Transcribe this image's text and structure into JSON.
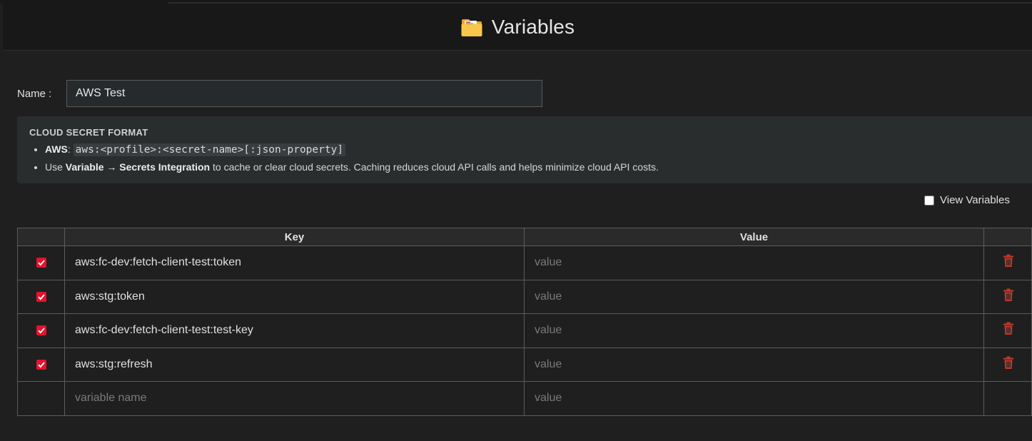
{
  "header": {
    "title": "Variables",
    "icon": "folder-icon"
  },
  "name_field": {
    "label": "Name :",
    "value": "AWS Test"
  },
  "info": {
    "heading": "CLOUD SECRET FORMAT",
    "aws_label": "AWS",
    "aws_colon": ":",
    "aws_format": "aws:<profile>:<secret-name>[:json-property]",
    "use_prefix": "Use ",
    "use_variable": "Variable",
    "use_arrow": " → ",
    "use_integration": "Secrets Integration",
    "use_suffix": " to cache or clear cloud secrets. Caching reduces cloud API calls and helps minimize cloud API costs."
  },
  "view_variables": {
    "label": "View Variables",
    "checked": false
  },
  "table": {
    "headers": {
      "check": "",
      "key": "Key",
      "value": "Value",
      "actions": ""
    },
    "rows": [
      {
        "checked": true,
        "key": "aws:fc-dev:fetch-client-test:token",
        "value": "",
        "value_placeholder": "value"
      },
      {
        "checked": true,
        "key": "aws:stg:token",
        "value": "",
        "value_placeholder": "value"
      },
      {
        "checked": true,
        "key": "aws:fc-dev:fetch-client-test:test-key",
        "value": "",
        "value_placeholder": "value"
      },
      {
        "checked": true,
        "key": "aws:stg:refresh",
        "value": "",
        "value_placeholder": "value"
      }
    ],
    "new_row": {
      "key_placeholder": "variable name",
      "value_placeholder": "value"
    }
  },
  "colors": {
    "check_red": "#e8112d",
    "trash_red": "#c0392b",
    "background": "#1f1f1f",
    "header_bg": "#181818"
  }
}
